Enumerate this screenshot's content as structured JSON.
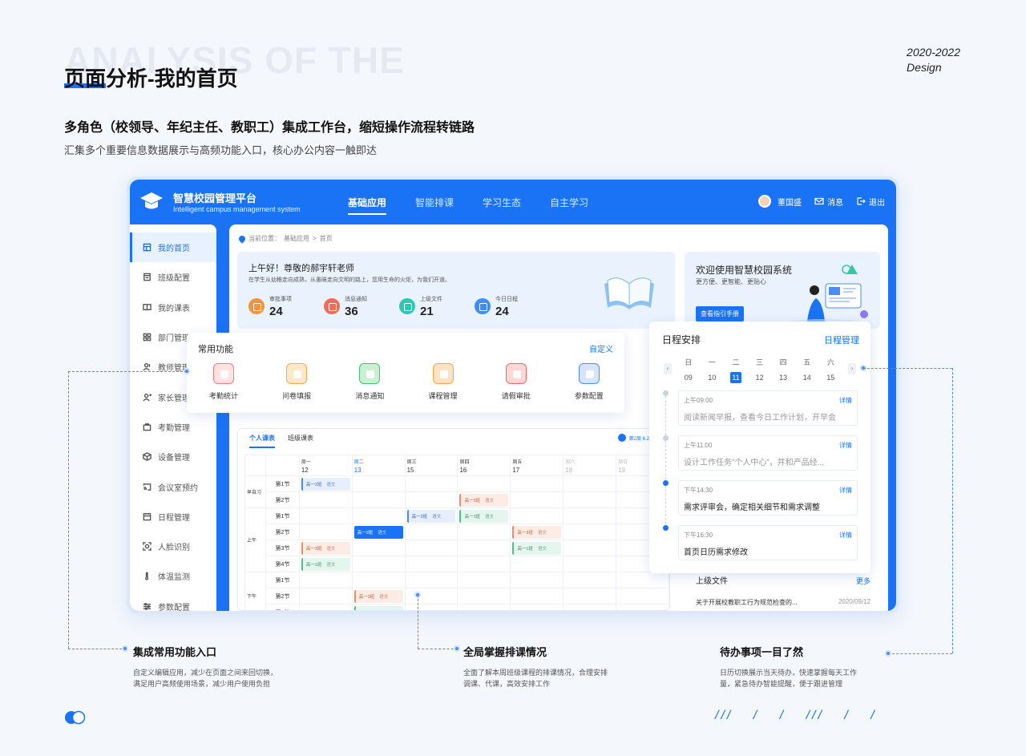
{
  "header": {
    "bg_text": "ANALYSIS OF THE",
    "title": "页面分析-我的首页",
    "year": "2020-2022",
    "design": "Design",
    "subtitle": "多角色（校领导、年纪主任、教职工）集成工作台，缩短操作流程转链路",
    "desc": "汇集多个重要信息数据展示与高频功能入口，核心办公内容一触即达"
  },
  "app": {
    "brand": "智慧校园管理平台",
    "brand_en": "Intelligent campus management system",
    "nav": [
      "基础应用",
      "智能排课",
      "学习生态",
      "自主学习"
    ],
    "user_name": "董国盛",
    "msg": "消息",
    "logout": "退出"
  },
  "sidebar": {
    "items": [
      {
        "label": "我的首页",
        "icon": "home-icon"
      },
      {
        "label": "班级配置",
        "icon": "class-icon"
      },
      {
        "label": "我的课表",
        "icon": "book-icon"
      },
      {
        "label": "部门管理",
        "icon": "grid-icon"
      },
      {
        "label": "教师管理",
        "icon": "teacher-icon"
      },
      {
        "label": "家长管理",
        "icon": "parent-icon"
      },
      {
        "label": "考勤管理",
        "icon": "briefcase-icon"
      },
      {
        "label": "设备管理",
        "icon": "device-icon"
      },
      {
        "label": "会议室预约",
        "icon": "cast-icon"
      },
      {
        "label": "日程管理",
        "icon": "calendar-icon"
      },
      {
        "label": "人脸识别",
        "icon": "face-icon"
      },
      {
        "label": "体温监测",
        "icon": "thermometer-icon"
      },
      {
        "label": "参数配置",
        "icon": "sliders-icon"
      }
    ]
  },
  "crumb": {
    "prefix": "当前位置：",
    "a": "基础应用",
    "sep": ">",
    "b": "首页"
  },
  "hello": {
    "title": "上午好！尊敬的郝宇轩老师",
    "sub": "在学生从幼稚走向成熟，从愚昧走向文明的路上，您用生命的火炬，为我们开道。",
    "stats": [
      {
        "label": "审批事项",
        "value": "24",
        "color": "#f5933d"
      },
      {
        "label": "消息通知",
        "value": "36",
        "color": "#f16a5a"
      },
      {
        "label": "上级文件",
        "value": "21",
        "color": "#2fc6b8"
      },
      {
        "label": "今日日程",
        "value": "24",
        "color": "#3d8ef7"
      }
    ]
  },
  "welcome": {
    "title": "欢迎使用智慧校园系统",
    "sub": "更方便、更智能、更贴心",
    "btn": "查看指引手册"
  },
  "quick": {
    "title": "常用功能",
    "custom": "自定义",
    "items": [
      {
        "label": "考勤统计",
        "color": "#f77a7a"
      },
      {
        "label": "问卷填报",
        "color": "#f7a94a"
      },
      {
        "label": "消息通知",
        "color": "#41c46b"
      },
      {
        "label": "课程管理",
        "color": "#f5a64a"
      },
      {
        "label": "请假审批",
        "color": "#f06565"
      },
      {
        "label": "参数配置",
        "color": "#4b8df5"
      }
    ]
  },
  "schedule": {
    "tabs": [
      "个人课表",
      "班级课表"
    ],
    "week": "第2周 6.24-6.30",
    "days": [
      {
        "wd": "周一",
        "d": "12"
      },
      {
        "wd": "周二",
        "d": "13"
      },
      {
        "wd": "周三",
        "d": "15"
      },
      {
        "wd": "周四",
        "d": "16"
      },
      {
        "wd": "周五",
        "d": "17"
      },
      {
        "wd": "周六",
        "d": "18"
      },
      {
        "wd": "周日",
        "d": "19"
      }
    ],
    "periods": [
      "早自习",
      "上午",
      "下午"
    ],
    "sections": [
      "第1节",
      "第2节",
      "第1节",
      "第2节",
      "第3节",
      "第4节",
      "第1节",
      "第2节",
      "第3节"
    ],
    "class_a": "高一2班",
    "class_b": "高一3班",
    "class_c": "高一1班",
    "subject": "语文"
  },
  "files": {
    "title": "上级文件",
    "more": "更多",
    "item": "关于开展校教职工行为规范检查的...",
    "date": "2020/09/12"
  },
  "calendar": {
    "title": "日程安排",
    "manage": "日程管理",
    "days": [
      {
        "wd": "日",
        "d": "09"
      },
      {
        "wd": "一",
        "d": "10"
      },
      {
        "wd": "二",
        "d": "11"
      },
      {
        "wd": "三",
        "d": "12"
      },
      {
        "wd": "四",
        "d": "13"
      },
      {
        "wd": "五",
        "d": "14"
      },
      {
        "wd": "六",
        "d": "15"
      }
    ],
    "events": [
      {
        "time": "上午09:00",
        "text": "阅读新闻早报，查看今日工作计划，开早会",
        "detail": "详情"
      },
      {
        "time": "上午11:00",
        "text": "设计工作任务”个人中心”，并和产品经...",
        "detail": "详情"
      },
      {
        "time": "下午14:30",
        "text": "需求评审会，确定相关细节和需求调整",
        "detail": "详情"
      },
      {
        "time": "下午16:30",
        "text": "首页日历需求修改",
        "detail": "详情"
      }
    ]
  },
  "notes": [
    {
      "title": "集成常用功能入口",
      "l1": "自定义编辑应用，减少在页面之间来回切换，",
      "l2": "满足用户高频使用场景，减少用户使用负担"
    },
    {
      "title": "全局掌握排课情况",
      "l1": "全面了解本周班级课程的排课情况，合理安排",
      "l2": "调课、代课，高效安排工作"
    },
    {
      "title": "待办事项一目了然",
      "l1": "日历切换展示当天待办，快速掌握每天工作",
      "l2": "量，紧急待办智能提醒，便于跟进管理"
    }
  ],
  "deco": {
    "slashes": "/// / / /// / /"
  }
}
